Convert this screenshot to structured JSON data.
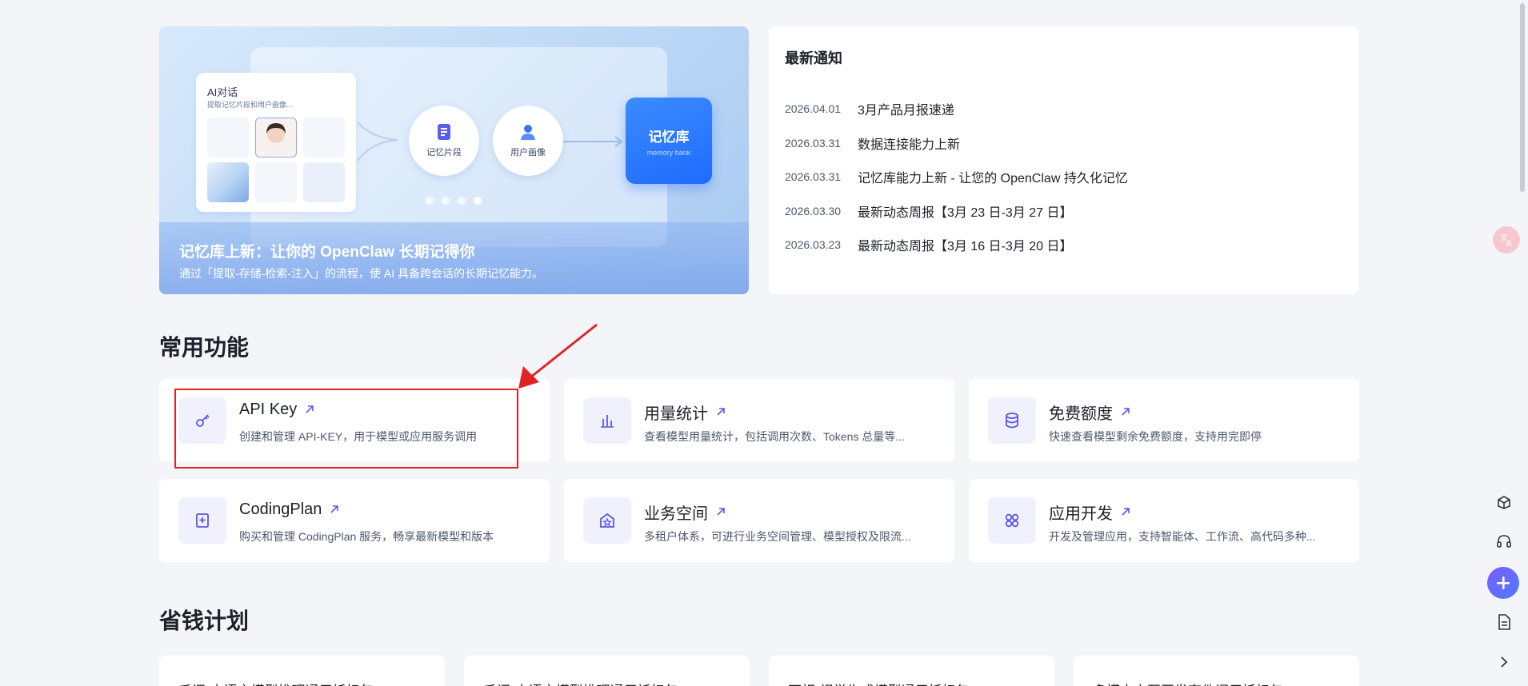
{
  "banner": {
    "chat_title": "AI对话",
    "chat_sub": "提取记忆片段和用户画像...",
    "circle1_label": "记忆片段",
    "circle2_label": "用户画像",
    "memory_title": "记忆库",
    "memory_sub": "memory bank",
    "title": "记忆库上新：让你的 OpenClaw 长期记得你",
    "desc": "通过「提取-存储-检索-注入」的流程，使 AI 具备跨会话的长期记忆能力。",
    "active_slide": 4,
    "slide_count": 4
  },
  "notices": {
    "title": "最新通知",
    "items": [
      {
        "date": "2026.04.01",
        "text": "3月产品月报速递"
      },
      {
        "date": "2026.03.31",
        "text": "数据连接能力上新"
      },
      {
        "date": "2026.03.31",
        "text": "记忆库能力上新 - 让您的 OpenClaw 持久化记忆"
      },
      {
        "date": "2026.03.30",
        "text": "最新动态周报【3月 23 日-3月 27 日】"
      },
      {
        "date": "2026.03.23",
        "text": "最新动态周报【3月 16 日-3月 20 日】"
      }
    ]
  },
  "common": {
    "title": "常用功能",
    "features": [
      {
        "name": "API Key",
        "desc": "创建和管理 API-KEY，用于模型或应用服务调用",
        "icon": "key-icon"
      },
      {
        "name": "用量统计",
        "desc": "查看模型用量统计，包括调用次数、Tokens 总量等...",
        "icon": "bar-chart-icon"
      },
      {
        "name": "免费额度",
        "desc": "快速查看模型剩余免费额度，支持用完即停",
        "icon": "database-icon"
      },
      {
        "name": "CodingPlan",
        "desc": "购买和管理 CodingPlan 服务，畅享最新模型和版本",
        "icon": "plus-square-icon"
      },
      {
        "name": "业务空间",
        "desc": "多租户体系，可进行业务空间管理、模型授权及限流...",
        "icon": "star-home-icon"
      },
      {
        "name": "应用开发",
        "desc": "开发及管理应用，支持智能体、工作流、高代码多种...",
        "icon": "apps-icon"
      }
    ]
  },
  "savings": {
    "title": "省钱计划",
    "plans": [
      {
        "text": "千问-大语言模型推理通用抵扣包"
      },
      {
        "text": "千问-大语言模型推理通用抵扣包"
      },
      {
        "text": "万相-视觉生成模型通用抵扣包"
      },
      {
        "text": "多模态交互开发套件调用抵扣包"
      }
    ]
  },
  "colors": {
    "accent": "#1f6bff",
    "highlight": "#e02424",
    "icon_bg": "#f0f1fd",
    "icon_fg": "#5b57e8"
  }
}
